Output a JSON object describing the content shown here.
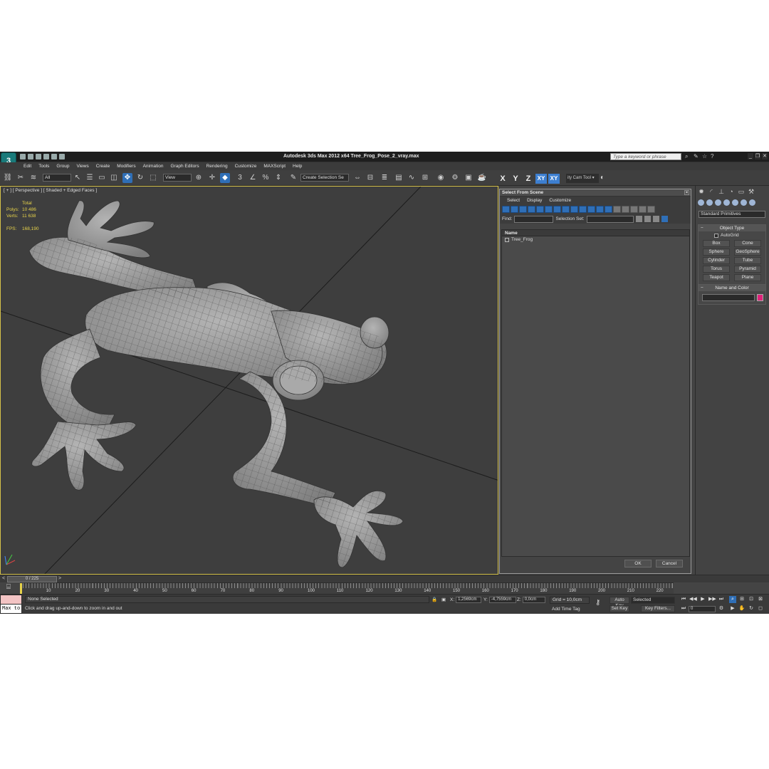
{
  "app": {
    "title": "Autodesk 3ds Max  2012 x64     Tree_Frog_Pose_2_vray.max",
    "logo": "3",
    "search_placeholder": "Type a keyword or phrase"
  },
  "menu": [
    "Edit",
    "Tools",
    "Group",
    "Views",
    "Create",
    "Modifiers",
    "Animation",
    "Graph Editors",
    "Rendering",
    "Customize",
    "MAXScript",
    "Help"
  ],
  "toolbar": {
    "filter": "All",
    "refcoord": "View",
    "selection_set": "Create Selection Se",
    "axes": [
      "X",
      "Y",
      "Z",
      "XY",
      "XY"
    ],
    "cam_tool": "ity Cam Tool ▾"
  },
  "viewport": {
    "label": "[ + ] [ Perspective ] [ Shaded + Edged Faces ]",
    "stats": {
      "header": "Total",
      "polys_label": "Polys:",
      "polys": "10 486",
      "verts_label": "Verts:",
      "verts": "11 638",
      "fps_label": "FPS:",
      "fps": "168,190"
    }
  },
  "dialog": {
    "title": "Select From Scene",
    "menu": [
      "Select",
      "Display",
      "Customize"
    ],
    "find_label": "Find:",
    "selset_label": "Selection Set:",
    "column": "Name",
    "items": [
      "Tree_Frog"
    ],
    "ok": "OK",
    "cancel": "Cancel"
  },
  "command_panel": {
    "category": "Standard Primitives",
    "object_type_title": "Object Type",
    "autogrid": "AutoGrid",
    "primitives": [
      "Box",
      "Cone",
      "Sphere",
      "GeoSphere",
      "Cylinder",
      "Tube",
      "Torus",
      "Pyramid",
      "Teapot",
      "Plane"
    ],
    "name_color_title": "Name and Color",
    "object_color": "#e0227a"
  },
  "timeline": {
    "frame": "0 / 225",
    "ticks": [
      "10",
      "20",
      "30",
      "40",
      "50",
      "60",
      "70",
      "80",
      "90",
      "100",
      "110",
      "120",
      "130",
      "140",
      "150",
      "160",
      "170",
      "180",
      "190",
      "200",
      "210",
      "220"
    ]
  },
  "status": {
    "maxscript": "Max to",
    "selection": "None Selected",
    "prompt": "Click and drag up-and-down to zoom in and out",
    "x_label": "X:",
    "x": "1,2569cm",
    "y_label": "Y:",
    "y": "-4,7559cm",
    "z_label": "Z:",
    "z": "0,0cm",
    "grid": "Grid = 10,0cm",
    "add_time_tag": "Add Time Tag",
    "auto_key": "Auto Key",
    "set_key": "Set Key",
    "selected": "Selected",
    "key_filters": "Key Filters...",
    "current_frame": "0"
  }
}
